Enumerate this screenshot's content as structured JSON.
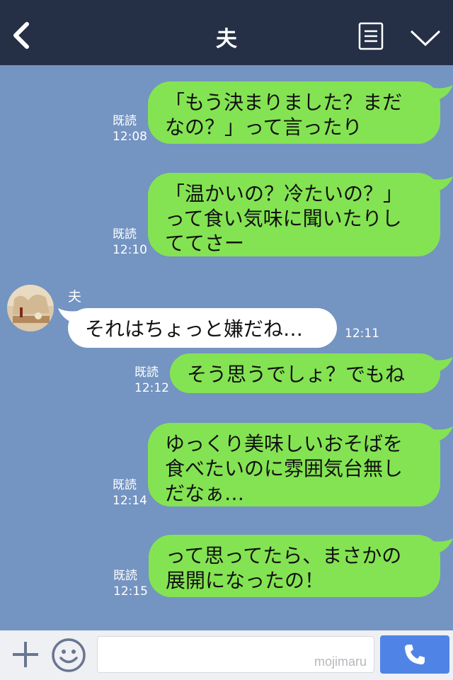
{
  "header": {
    "title": "夫",
    "back_icon": "chevron-left-icon",
    "menu_icon": "list-icon",
    "more_icon": "chevron-down-icon",
    "background": "#252f46"
  },
  "chat": {
    "background": "#7494c1",
    "sent_color": "#84e352",
    "received_color": "#ffffff",
    "messages": [
      {
        "side": "sent",
        "text": "「もう決まりました？まだ\nなの？」って言ったり",
        "read": "既読",
        "time": "12:08"
      },
      {
        "side": "sent",
        "text": "「温かいの？冷たいの？」\nって食い気味に聞いたりし\nててさー",
        "read": "既読",
        "time": "12:10"
      },
      {
        "side": "received",
        "sender": "夫",
        "text": "それはちょっと嫌だね…",
        "time": "12:11"
      },
      {
        "side": "sent",
        "text": "そう思うでしょ？でもね",
        "read": "既読",
        "time": "12:12"
      },
      {
        "side": "sent",
        "text": "ゆっくり美味しいおそばを\n食べたいのに雰囲気台無し\nだなぁ…",
        "read": "既読",
        "time": "12:14"
      },
      {
        "side": "sent",
        "text": "って思ってたら、まさかの\n展開になったの！",
        "read": "既読",
        "time": "12:15"
      }
    ]
  },
  "footer": {
    "plus_icon": "plus-icon",
    "emoji_icon": "smile-icon",
    "input_value": "",
    "watermark": "mojimaru",
    "call_icon": "phone-icon",
    "call_color": "#4f84e6"
  }
}
